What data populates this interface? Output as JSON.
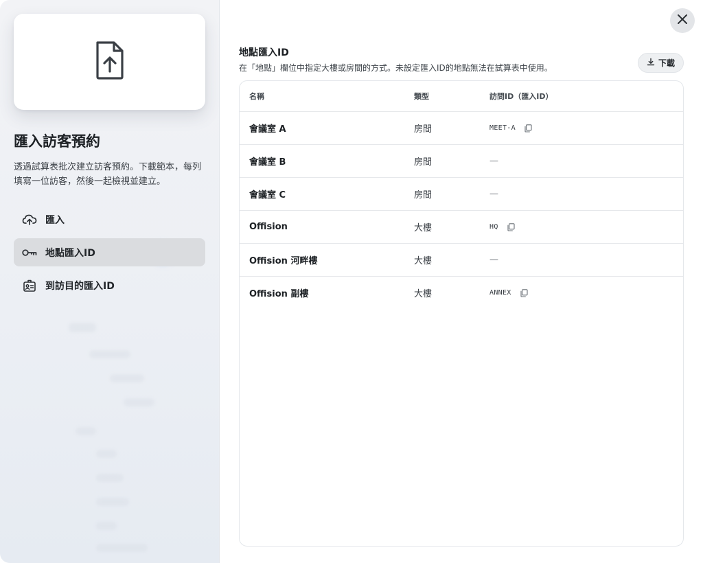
{
  "left": {
    "title": "匯入訪客預約",
    "description": "透過試算表批次建立訪客預約。下載範本，每列填寫一位訪客，然後一起檢視並建立。",
    "nav": [
      {
        "label": "匯入",
        "icon": "cloud-upload-icon",
        "active": false
      },
      {
        "label": "地點匯入ID",
        "icon": "key-icon",
        "active": true
      },
      {
        "label": "到訪目的匯入ID",
        "icon": "badge-icon",
        "active": false
      }
    ]
  },
  "main": {
    "section_title": "地點匯入ID",
    "section_description": "在「地點」欄位中指定大樓或房間的方式。未設定匯入ID的地點無法在試算表中使用。",
    "download_label": "下載",
    "columns": {
      "name": "名稱",
      "type": "類型",
      "import_id": "訪問ID（匯入ID）"
    },
    "rows": [
      {
        "name": "會議室 A",
        "type": "房間",
        "import_id": "MEET-A",
        "copy": true
      },
      {
        "name": "會議室 B",
        "type": "房間",
        "import_id": "—",
        "copy": false
      },
      {
        "name": "會議室 C",
        "type": "房間",
        "import_id": "—",
        "copy": false
      },
      {
        "name": "Offision",
        "type": "大樓",
        "import_id": "HQ",
        "copy": true
      },
      {
        "name": "Offision 河畔樓",
        "type": "大樓",
        "import_id": "—",
        "copy": false
      },
      {
        "name": "Offision 副樓",
        "type": "大樓",
        "import_id": "ANNEX",
        "copy": true
      }
    ]
  },
  "colors": {
    "active_nav_bg": "#dadcdf",
    "panel_bg": "#eef1f5",
    "close_bg": "#e3e5e8"
  }
}
